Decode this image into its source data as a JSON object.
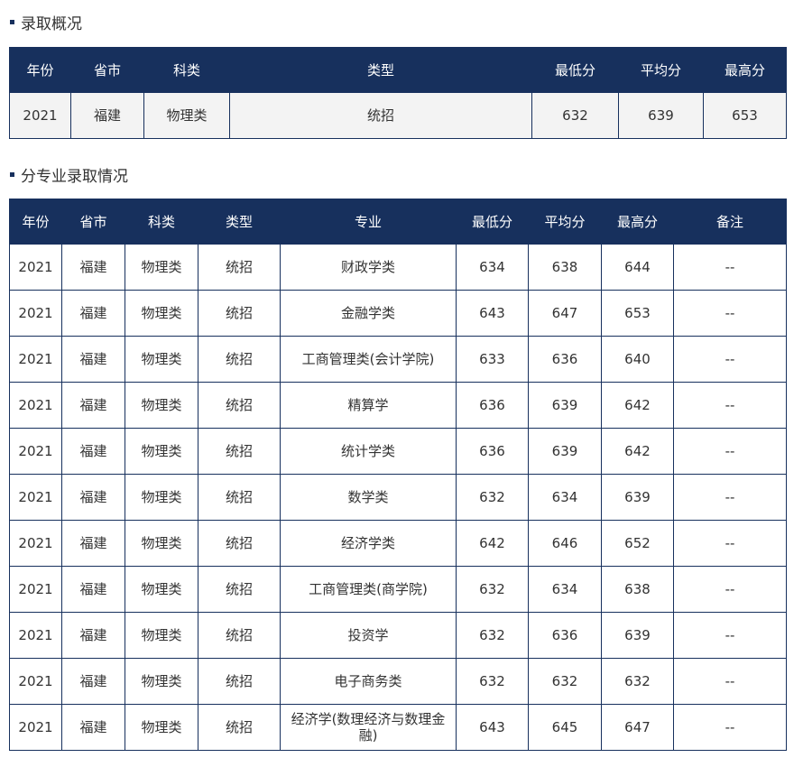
{
  "overview": {
    "title": "录取概况",
    "headers": [
      "年份",
      "省市",
      "科类",
      "类型",
      "最低分",
      "平均分",
      "最高分"
    ],
    "row": [
      "2021",
      "福建",
      "物理类",
      "统招",
      "632",
      "639",
      "653"
    ]
  },
  "majors": {
    "title": "分专业录取情况",
    "headers": [
      "年份",
      "省市",
      "科类",
      "类型",
      "专业",
      "最低分",
      "平均分",
      "最高分",
      "备注"
    ],
    "rows": [
      [
        "2021",
        "福建",
        "物理类",
        "统招",
        "财政学类",
        "634",
        "638",
        "644",
        "--"
      ],
      [
        "2021",
        "福建",
        "物理类",
        "统招",
        "金融学类",
        "643",
        "647",
        "653",
        "--"
      ],
      [
        "2021",
        "福建",
        "物理类",
        "统招",
        "工商管理类(会计学院)",
        "633",
        "636",
        "640",
        "--"
      ],
      [
        "2021",
        "福建",
        "物理类",
        "统招",
        "精算学",
        "636",
        "639",
        "642",
        "--"
      ],
      [
        "2021",
        "福建",
        "物理类",
        "统招",
        "统计学类",
        "636",
        "639",
        "642",
        "--"
      ],
      [
        "2021",
        "福建",
        "物理类",
        "统招",
        "数学类",
        "632",
        "634",
        "639",
        "--"
      ],
      [
        "2021",
        "福建",
        "物理类",
        "统招",
        "经济学类",
        "642",
        "646",
        "652",
        "--"
      ],
      [
        "2021",
        "福建",
        "物理类",
        "统招",
        "工商管理类(商学院)",
        "632",
        "634",
        "638",
        "--"
      ],
      [
        "2021",
        "福建",
        "物理类",
        "统招",
        "投资学",
        "632",
        "636",
        "639",
        "--"
      ],
      [
        "2021",
        "福建",
        "物理类",
        "统招",
        "电子商务类",
        "632",
        "632",
        "632",
        "--"
      ],
      [
        "2021",
        "福建",
        "物理类",
        "统招",
        "经济学(数理经济与数理金融)",
        "643",
        "645",
        "647",
        "--"
      ]
    ]
  }
}
